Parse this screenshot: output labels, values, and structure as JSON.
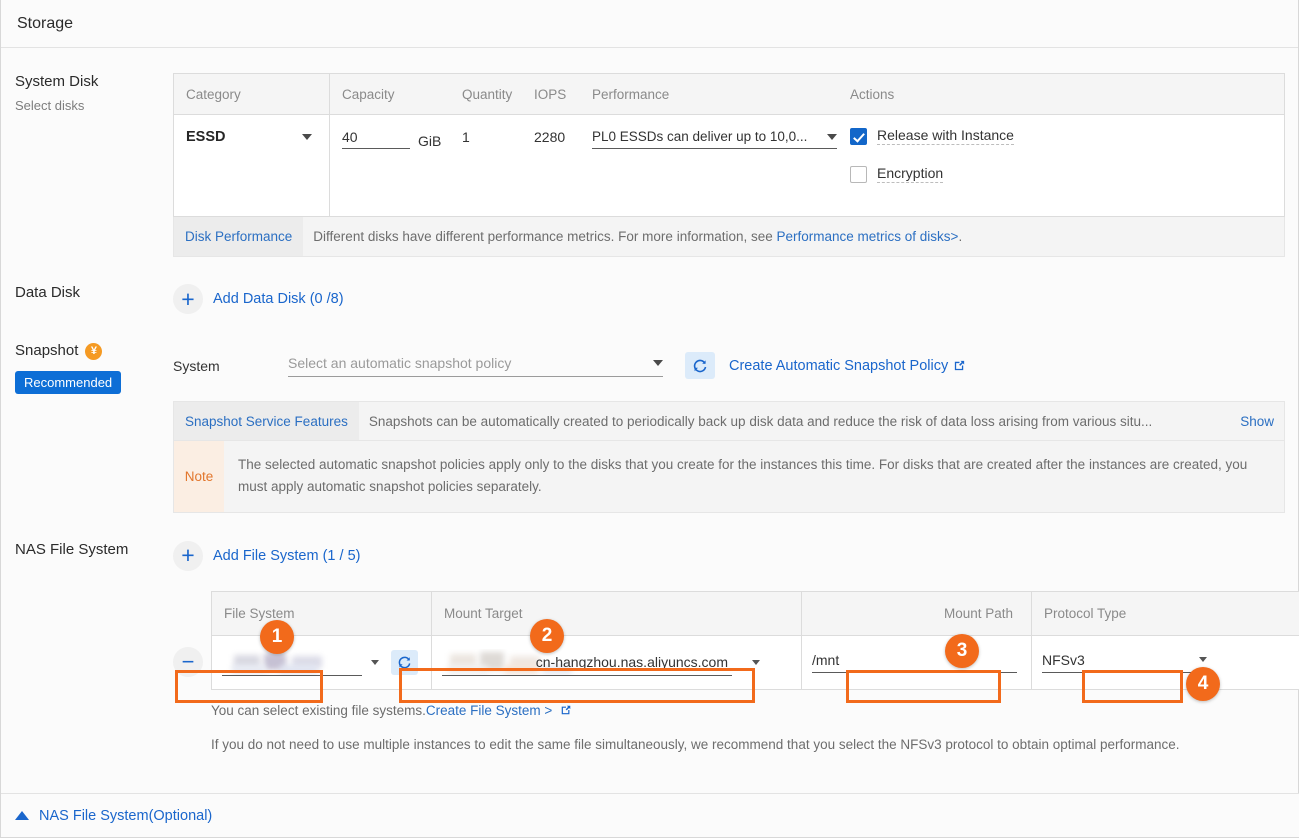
{
  "header": {
    "title": "Storage"
  },
  "system_disk": {
    "label": "System Disk",
    "sublabel": "Select disks",
    "columns": [
      "Category",
      "Capacity",
      "Quantity",
      "IOPS",
      "Performance",
      "Actions"
    ],
    "category_value": "ESSD",
    "capacity_value": "40",
    "capacity_unit": "GiB",
    "quantity_value": "1",
    "iops_value": "2280",
    "performance_value": "PL0 ESSDs can deliver up to 10,0...",
    "release_with_instance_label": "Release with Instance",
    "release_with_instance_checked": true,
    "encryption_label": "Encryption",
    "encryption_checked": false,
    "info_tag": "Disk Performance",
    "info_text": "Different disks have different performance metrics. For more information, see ",
    "info_link": "Performance metrics of disks>",
    "info_text_end": "."
  },
  "data_disk": {
    "label": "Data Disk",
    "add_label": "Add Data Disk (0 /8)",
    "plus_icon": "plus-icon"
  },
  "snapshot": {
    "label": "Snapshot",
    "yen_icon": "yen-badge-icon",
    "recommended_badge": "Recommended",
    "system_label": "System",
    "policy_placeholder": "Select an automatic snapshot policy",
    "refresh_icon": "refresh-icon",
    "create_policy_link": "Create Automatic Snapshot Policy",
    "external_icon": "external-link-icon",
    "features_tag": "Snapshot Service Features",
    "features_text": "Snapshots can be automatically created to periodically back up disk data and reduce the risk of data loss arising from various situ...",
    "show_link": "Show",
    "note_tag": "Note",
    "note_text": "The selected automatic snapshot policies apply only to the disks that you create for the instances this time. For disks that are created after the instances are created, you must apply automatic snapshot policies separately."
  },
  "nas": {
    "label": "NAS File System",
    "add_label": "Add File System (1 / 5)",
    "columns": [
      "File System",
      "Mount Target",
      "Mount Path",
      "Protocol Type"
    ],
    "file_system_value": "",
    "mount_target_value": "cn-hangzhou.nas.aliyuncs.com",
    "mount_path_value": "/mnt",
    "protocol_type_value": "NFSv3",
    "remove_icon": "minus-icon",
    "refresh_icon": "refresh-icon",
    "hint1_text": "You can select existing file systems.",
    "hint1_link": "Create File System >",
    "hint2_text": "If you do not need to use multiple instances to edit the same file simultaneously, we recommend that you select the NFSv3 protocol to obtain optimal performance.",
    "annotations": [
      {
        "number": "1"
      },
      {
        "number": "2"
      },
      {
        "number": "3"
      },
      {
        "number": "4"
      }
    ]
  },
  "footer": {
    "collapse_icon": "triangle-up-icon",
    "label": "NAS File System(Optional)"
  },
  "colors": {
    "link": "#1a66cc",
    "accent_orange": "#f26a1b",
    "badge_blue": "#0d6ed6",
    "checkbox_blue": "#1266c9",
    "yen_orange": "#f59a23"
  }
}
